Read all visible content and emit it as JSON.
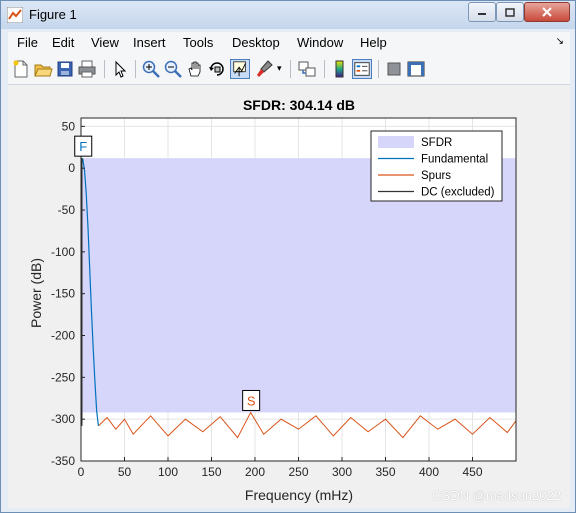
{
  "window": {
    "title": "Figure 1",
    "icon": "matlab-figure-icon"
  },
  "menu": [
    "File",
    "Edit",
    "View",
    "Insert",
    "Tools",
    "Desktop",
    "Window",
    "Help"
  ],
  "toolbar": [
    "new-figure-icon",
    "open-file-icon",
    "save-icon",
    "print-icon",
    "edit-plot-icon",
    "zoom-in-icon",
    "zoom-out-icon",
    "pan-icon",
    "rotate-3d-icon",
    "data-cursor-icon",
    "brush-icon",
    "link-plot-icon",
    "colorbar-icon",
    "legend-icon",
    "hide-plot-tools-icon",
    "show-plot-tools-icon"
  ],
  "chart_data": {
    "type": "line",
    "title": "SFDR: 304.14 dB",
    "xlabel": "Frequency (mHz)",
    "ylabel": "Power (dB)",
    "xlim": [
      0,
      500
    ],
    "ylim": [
      -350,
      60
    ],
    "xticks": [
      0,
      50,
      100,
      150,
      200,
      250,
      300,
      350,
      400,
      450
    ],
    "yticks": [
      50,
      0,
      -50,
      -100,
      -150,
      -200,
      -250,
      -300,
      -350
    ],
    "grid": true,
    "legend_position": "top-right",
    "sfdr_band": {
      "upper": 12,
      "lower": -292
    },
    "series": [
      {
        "name": "SFDR",
        "color": "#d6d6fa",
        "kind": "band"
      },
      {
        "name": "Fundamental",
        "color": "#0072bd",
        "x": [
          0,
          2,
          4,
          6,
          8,
          10,
          12,
          14,
          16,
          18,
          20
        ],
        "y": [
          12,
          11,
          -2,
          -30,
          -70,
          -120,
          -170,
          -215,
          -255,
          -290,
          -308
        ]
      },
      {
        "name": "Spurs",
        "color": "#d95319",
        "x": [
          20,
          30,
          40,
          50,
          60,
          80,
          100,
          120,
          140,
          160,
          180,
          195,
          210,
          230,
          250,
          270,
          290,
          310,
          330,
          350,
          370,
          390,
          410,
          430,
          450,
          470,
          490,
          500
        ],
        "y": [
          -308,
          -298,
          -312,
          -300,
          -318,
          -296,
          -320,
          -300,
          -315,
          -297,
          -322,
          -292,
          -318,
          -300,
          -312,
          -296,
          -320,
          -298,
          -315,
          -300,
          -322,
          -296,
          -312,
          -300,
          -318,
          -298,
          -316,
          -302
        ]
      },
      {
        "name": "DC (excluded)",
        "color": "#333333"
      }
    ],
    "markers": [
      {
        "label": "F",
        "x": 2,
        "y": 12,
        "color": "#0072bd"
      },
      {
        "label": "S",
        "x": 195,
        "y": -292,
        "color": "#d95319"
      }
    ]
  },
  "watermark": "CSDN @madson2022"
}
